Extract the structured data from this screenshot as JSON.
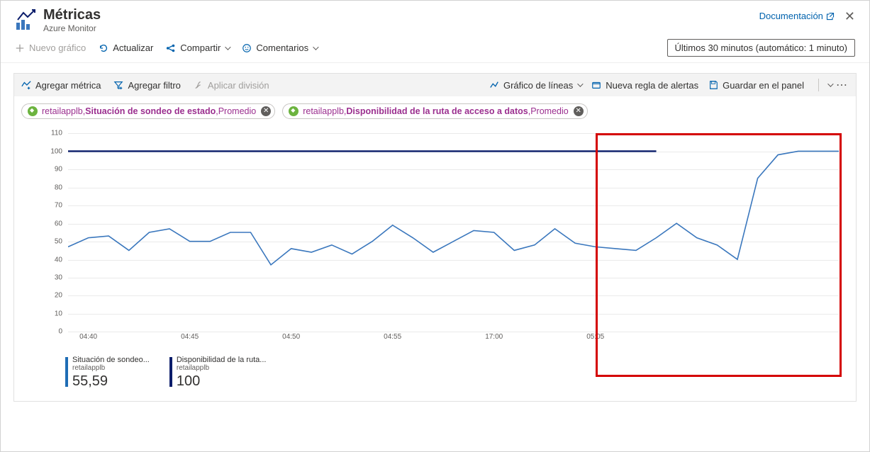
{
  "header": {
    "title": "Métricas",
    "subtitle": "Azure Monitor",
    "docs_label": "Documentación"
  },
  "cmdbar": {
    "new_chart": "Nuevo gráfico",
    "refresh": "Actualizar",
    "share": "Compartir",
    "feedback": "Comentarios",
    "time_range": "Últimos 30 minutos (automático: 1 minuto)"
  },
  "panelbar": {
    "add_metric": "Agregar métrica",
    "add_filter": "Agregar filtro",
    "apply_split": "Aplicar división",
    "chart_type": "Gráfico de líneas",
    "new_alert": "Nueva regla de alertas",
    "save_dash": "Guardar en el panel"
  },
  "chips": [
    {
      "resource": "retailapplb",
      "metric": "Situación de sondeo de estado",
      "agg": "Promedio"
    },
    {
      "resource": "retailapplb",
      "metric": "Disponibilidad de la ruta de acceso a datos",
      "agg": "Promedio"
    }
  ],
  "legend": [
    {
      "title": "Situación de sondeo...",
      "resource": "retailapplb",
      "value": "55,59"
    },
    {
      "title": "Disponibilidad de la ruta...",
      "resource": "retailapplb",
      "value": "100"
    }
  ],
  "chart_data": {
    "type": "line",
    "ylim": [
      0,
      110
    ],
    "y_ticks": [
      0,
      10,
      20,
      30,
      40,
      50,
      60,
      70,
      80,
      90,
      100,
      110
    ],
    "x_ticks": [
      "04:40",
      "04:45",
      "04:50",
      "04:55",
      "17:00",
      "05:05"
    ],
    "x_tick_indices": [
      1,
      6,
      11,
      16,
      21,
      26
    ],
    "n_points": 30,
    "series": [
      {
        "name": "Disponibilidad de la ruta de acceso a datos",
        "color": "#0b1d6b",
        "values": [
          100,
          100,
          100,
          100,
          100,
          100,
          100,
          100,
          100,
          100,
          100,
          100,
          100,
          100,
          100,
          100,
          100,
          100,
          100,
          100,
          100,
          100,
          100,
          100,
          100,
          100,
          100,
          100,
          100,
          100
        ]
      },
      {
        "name": "Situación de sondeo de estado",
        "color": "#3a77bd",
        "values": [
          47,
          52,
          53,
          45,
          55,
          57,
          50,
          50,
          55,
          55,
          37,
          46,
          44,
          48,
          43,
          50,
          59,
          52,
          44,
          50,
          56,
          55,
          45,
          48,
          57,
          49,
          47,
          46,
          45,
          52,
          60,
          52,
          48,
          40,
          85,
          98,
          100,
          100,
          100
        ]
      }
    ],
    "n_points_override": 30,
    "highlight": {
      "from_index": 26,
      "to_index": 29
    }
  }
}
